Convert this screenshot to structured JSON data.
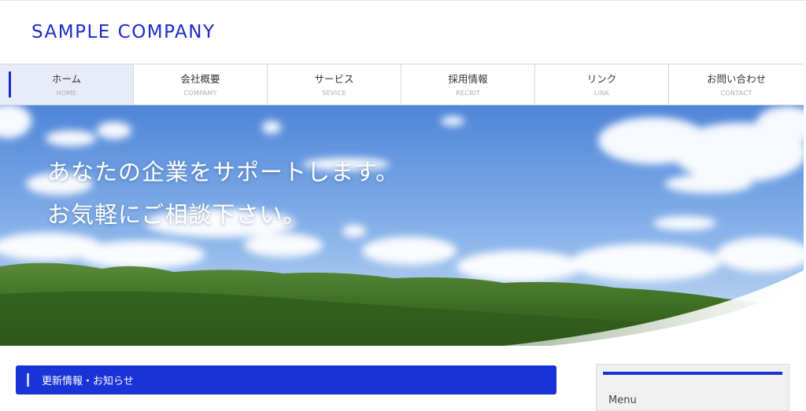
{
  "header": {
    "logo": "SAMPLE COMPANY"
  },
  "nav": {
    "items": [
      {
        "label": "ホーム",
        "sub": "HOME"
      },
      {
        "label": "会社概要",
        "sub": "COMPAMY"
      },
      {
        "label": "サービス",
        "sub": "SEVICE"
      },
      {
        "label": "採用情報",
        "sub": "RECRIT"
      },
      {
        "label": "リンク",
        "sub": "LINK"
      },
      {
        "label": "お問い合わせ",
        "sub": "CONTACT"
      }
    ]
  },
  "hero": {
    "line1": "あなたの企業をサポートします。",
    "line2": "お気軽にご相談下さい。"
  },
  "news": {
    "title": "更新情報・お知らせ"
  },
  "sidebar": {
    "title": "Menu"
  },
  "colors": {
    "accent": "#1a33d6",
    "logo": "#1a2bc8",
    "nav_active_bg": "#e8ecf8"
  }
}
